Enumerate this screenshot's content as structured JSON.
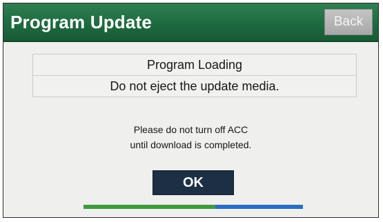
{
  "header": {
    "title": "Program Update",
    "back_label": "Back"
  },
  "messages": [
    "Program Loading",
    "Do not eject the update media."
  ],
  "notice": {
    "line1": "Please do not turn off ACC",
    "line2": "until download is completed."
  },
  "ok_label": "OK",
  "progress": {
    "fraction": 0.6
  },
  "colors": {
    "header_green": "#1f6a40",
    "ok_button_navy": "#1d2f44",
    "progress_green": "#3f9a3c",
    "progress_blue": "#2a6fc1"
  }
}
